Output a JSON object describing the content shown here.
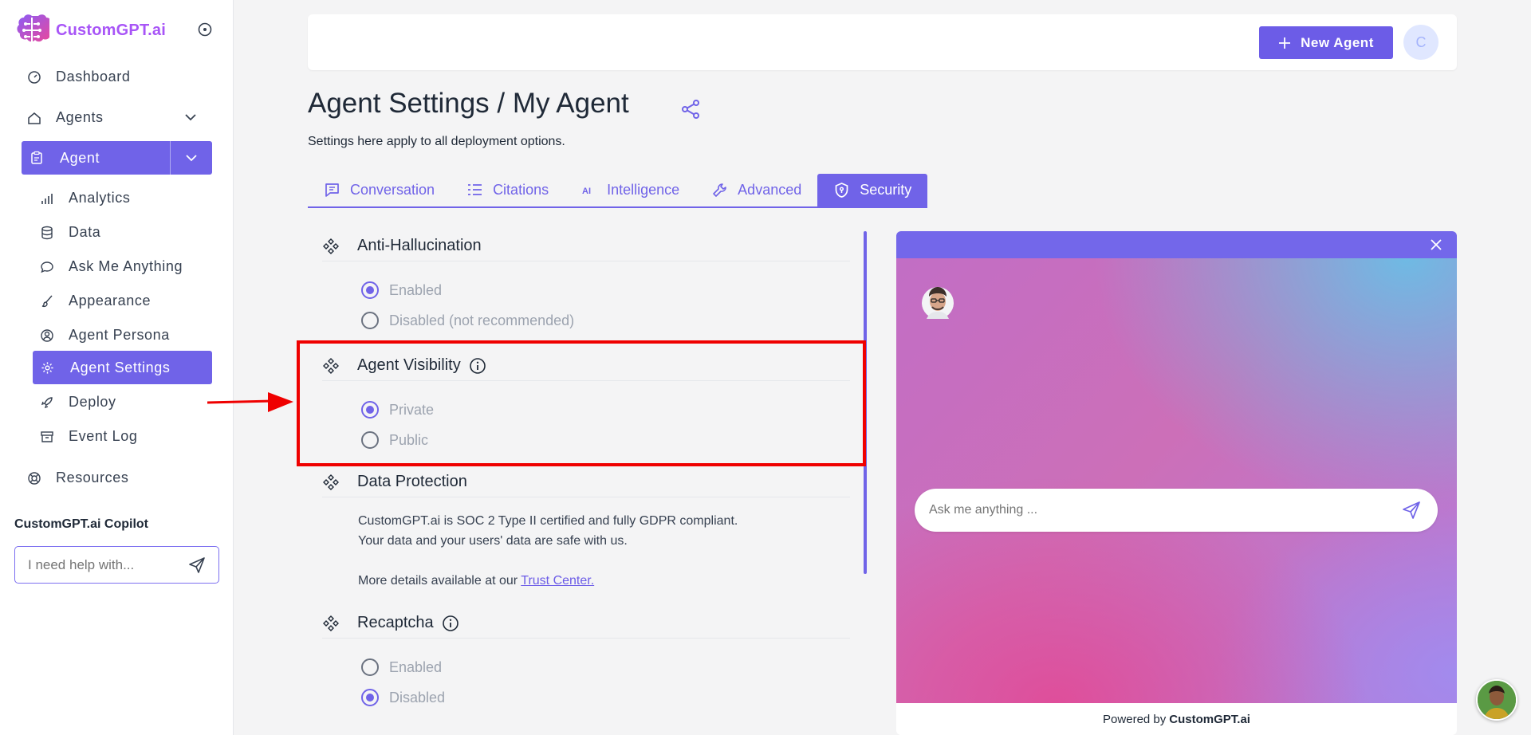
{
  "brand": {
    "name": "CustomGPT.ai"
  },
  "sidebar": {
    "dashboard": "Dashboard",
    "agents": "Agents",
    "agent": "Agent",
    "sub_items": [
      {
        "label": "Analytics",
        "icon": "chart-bar-icon"
      },
      {
        "label": "Data",
        "icon": "database-icon"
      },
      {
        "label": "Ask Me Anything",
        "icon": "chat-bubble-icon"
      },
      {
        "label": "Appearance",
        "icon": "brush-icon"
      },
      {
        "label": "Agent Persona",
        "icon": "user-circle-icon"
      },
      {
        "label": "Agent Settings",
        "icon": "gear-icon"
      },
      {
        "label": "Deploy",
        "icon": "rocket-icon"
      },
      {
        "label": "Event Log",
        "icon": "archive-icon"
      }
    ],
    "resources": "Resources",
    "copilot_title": "CustomGPT.ai Copilot",
    "copilot_placeholder": "I need help with..."
  },
  "header": {
    "new_agent_label": "New Agent",
    "avatar_initial": "C"
  },
  "page": {
    "title": "Agent Settings / My Agent",
    "subtitle": "Settings here apply to all deployment options."
  },
  "tabs": [
    {
      "label": "Conversation",
      "icon": "chat-icon"
    },
    {
      "label": "Citations",
      "icon": "list-icon"
    },
    {
      "label": "Intelligence",
      "icon": "ai-icon"
    },
    {
      "label": "Advanced",
      "icon": "wrench-icon"
    },
    {
      "label": "Security",
      "icon": "shield-icon",
      "active": true
    }
  ],
  "sections": {
    "anti_hallucination": {
      "title": "Anti-Hallucination",
      "options": [
        "Enabled",
        "Disabled (not recommended)"
      ],
      "selected": "Enabled"
    },
    "agent_visibility": {
      "title": "Agent Visibility",
      "options": [
        "Private",
        "Public"
      ],
      "selected": "Private"
    },
    "data_protection": {
      "title": "Data Protection",
      "line1": "CustomGPT.ai is SOC 2 Type II certified and fully GDPR compliant.",
      "line2": "Your data and your users' data are safe with us.",
      "line3_prefix": "More details available at our",
      "link": "Trust Center."
    },
    "recaptcha": {
      "title": "Recaptcha",
      "options": [
        "Enabled",
        "Disabled"
      ],
      "selected": "Disabled"
    }
  },
  "chat_preview": {
    "placeholder": "Ask me anything ...",
    "powered_prefix": "Powered by",
    "powered_brand": "CustomGPT.ai"
  },
  "colors": {
    "accent": "#7063e8",
    "highlight": "#ef0000",
    "brand": "#a855f7"
  }
}
